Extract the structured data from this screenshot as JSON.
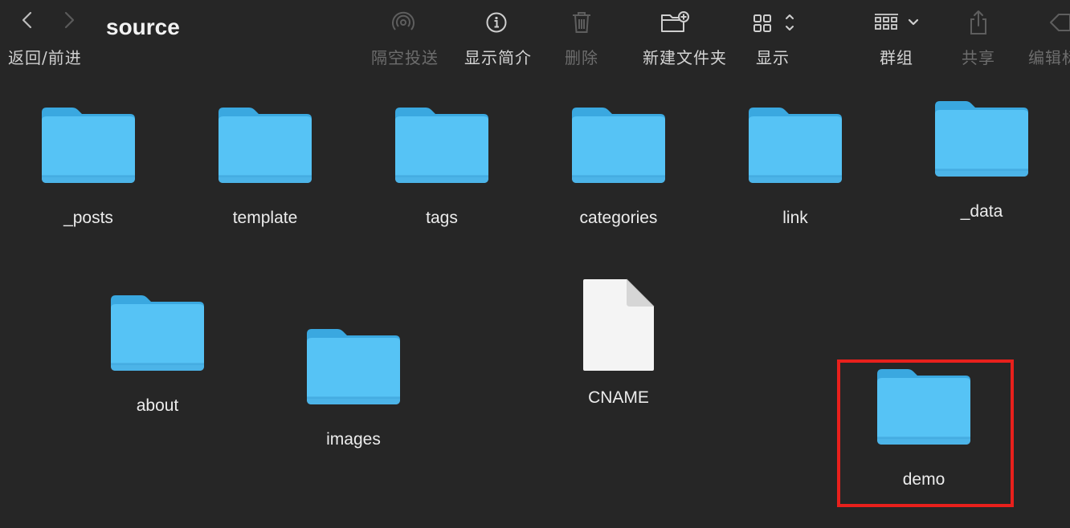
{
  "toolbar": {
    "nav_label": "返回/前进",
    "title": "source",
    "items": [
      {
        "label": "隔空投送",
        "icon": "airdrop-icon",
        "enabled": false
      },
      {
        "label": "显示简介",
        "icon": "info-icon",
        "enabled": true
      },
      {
        "label": "删除",
        "icon": "trash-icon",
        "enabled": false
      },
      {
        "label": "新建文件夹",
        "icon": "new-folder-icon",
        "enabled": true
      },
      {
        "label": "显示",
        "icon": "view-grid-icon",
        "enabled": true
      },
      {
        "label": "群组",
        "icon": "group-icon",
        "enabled": true
      },
      {
        "label": "共享",
        "icon": "share-icon",
        "enabled": false
      },
      {
        "label": "编辑标",
        "icon": "tag-icon",
        "enabled": false
      }
    ]
  },
  "files": [
    {
      "name": "_posts",
      "kind": "folder"
    },
    {
      "name": "template",
      "kind": "folder"
    },
    {
      "name": "tags",
      "kind": "folder"
    },
    {
      "name": "categories",
      "kind": "folder"
    },
    {
      "name": "link",
      "kind": "folder"
    },
    {
      "name": "_data",
      "kind": "folder"
    },
    {
      "name": "about",
      "kind": "folder"
    },
    {
      "name": "images",
      "kind": "folder"
    },
    {
      "name": "CNAME",
      "kind": "document"
    },
    {
      "name": "demo",
      "kind": "folder",
      "highlighted": true
    }
  ],
  "colors": {
    "background": "#262626",
    "folder": "#56c3f5",
    "highlight": "#e8201c"
  }
}
